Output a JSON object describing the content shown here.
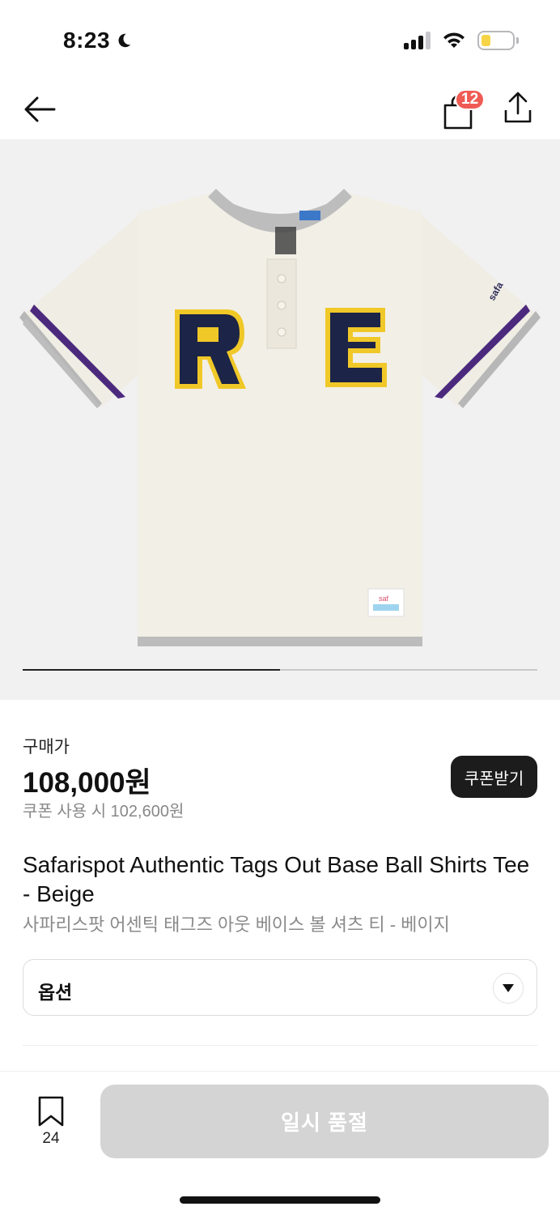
{
  "status_bar": {
    "time": "8:23",
    "moon_icon": "moon-icon",
    "signal_icon": "cellular-signal-icon",
    "wifi_icon": "wifi-icon",
    "battery_icon": "battery-low-icon"
  },
  "nav": {
    "back_icon": "arrow-left-icon",
    "cart_icon": "shopping-bag-icon",
    "cart_count": "12",
    "share_icon": "share-icon"
  },
  "product_image": {
    "alt": "Safarispot baseball henley tee with R E letters",
    "slide_progress": 0.5
  },
  "price": {
    "label": "구매가",
    "value": "108,000원",
    "coupon_text": "쿠폰 사용 시 102,600원",
    "coupon_button": "쿠폰받기"
  },
  "product": {
    "title_en": "Safarispot Authentic Tags Out Base Ball Shirts Tee - Beige",
    "title_ko": "사파리스팟 어센틱 태그즈 아웃 베이스 볼 셔츠 티 - 베이지"
  },
  "option": {
    "label": "옵션",
    "chevron_icon": "chevron-down-icon"
  },
  "bottom": {
    "bookmark_icon": "bookmark-icon",
    "bookmark_count": "24",
    "soldout_label": "일시 품절"
  },
  "colors": {
    "badge": "#ef5b54",
    "coupon_button_bg": "#1c1c1c",
    "soldout_bg": "#d4d4d4",
    "image_bg": "#f1f1f1"
  }
}
